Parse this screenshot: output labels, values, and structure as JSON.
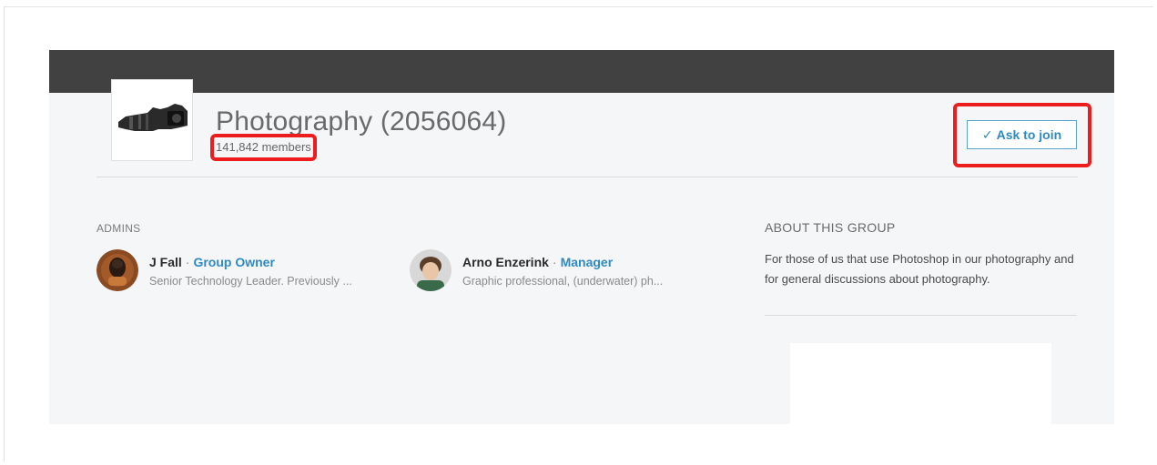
{
  "group": {
    "name": "Photography (2056064)",
    "members": "141,842 members",
    "logo_icon": "camera-lens-icon"
  },
  "join": {
    "check_glyph": "✓",
    "label": "Ask to join"
  },
  "admins": {
    "label": "ADMINS",
    "items": [
      {
        "name": "J Fall",
        "separator": "·",
        "role": "Group Owner",
        "description": "Senior Technology Leader. Previously ..."
      },
      {
        "name": "Arno Enzerink",
        "separator": "·",
        "role": "Manager",
        "description": "Graphic professional, (underwater) ph..."
      }
    ]
  },
  "about": {
    "label": "ABOUT THIS GROUP",
    "text": "For those of us that use Photoshop in our photography and for general discussions about photography."
  },
  "colors": {
    "topbar": "#414141",
    "accent": "#2f8ac2",
    "highlight": "#ee1d1d",
    "background": "#f4f6f8"
  }
}
